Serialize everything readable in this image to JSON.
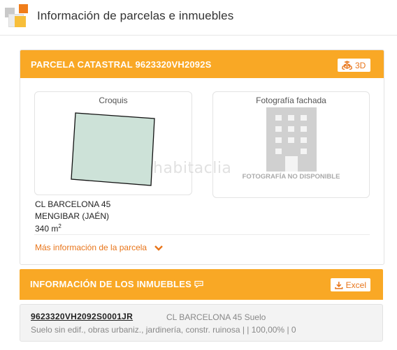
{
  "header": {
    "title": "Información de parcelas e inmuebles"
  },
  "parcel": {
    "title": "PARCELA CATASTRAL 9623320VH2092S",
    "btn_3d_label": "3D",
    "sketch_label": "Croquis",
    "facade_label": "Fotografía fachada",
    "no_photo_label": "FOTOGRAFÍA NO DISPONIBLE",
    "watermark": "habitaclia",
    "address_line1": "CL BARCELONA 45",
    "address_line2": "MENGIBAR (JAÉN)",
    "area_value": "340 m",
    "area_sup": "2",
    "more_info_label": "Más información de la parcela"
  },
  "properties": {
    "title": "INFORMACIÓN DE LOS INMUEBLES",
    "excel_label": "Excel",
    "items": [
      {
        "ref": "9623320VH2092S0001JR",
        "address": "CL BARCELONA 45 Suelo",
        "description": "Suelo sin edif., obras urbaniz., jardinería, constr. ruinosa | | 100,00% | 0"
      }
    ]
  },
  "colors": {
    "accent": "#f9a825",
    "link": "#e8751a"
  }
}
